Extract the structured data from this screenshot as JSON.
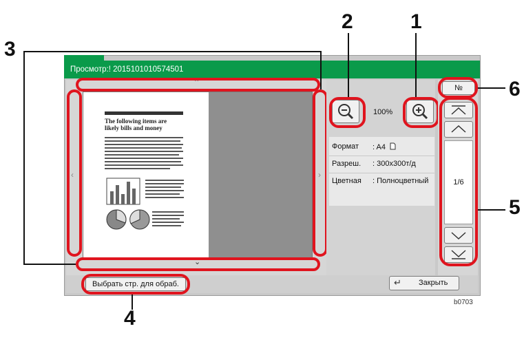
{
  "callouts": {
    "c1": "1",
    "c2": "2",
    "c3": "3",
    "c4": "4",
    "c5": "5",
    "c6": "6"
  },
  "preview": {
    "title": "Просмотр:! 2015101010574501"
  },
  "zoom": {
    "level": "100%"
  },
  "info": {
    "format_label": "Формат",
    "format_value": ": A4",
    "resolution_label": "Разреш.",
    "resolution_value": ": 300x300т/д",
    "color_label": "Цветная",
    "color_value": ": Полноцветный"
  },
  "pager": {
    "number_button": "№",
    "page_indicator": "1/6"
  },
  "buttons": {
    "select_pages": "Выбрать стр. для обраб.",
    "close": "Закрыть"
  },
  "doc_page": {
    "heading": "The following items are likely bills and money"
  },
  "figure_code": "b0703",
  "colors": {
    "title_green": "#0a9a4a",
    "highlight_red": "#e0141e"
  }
}
